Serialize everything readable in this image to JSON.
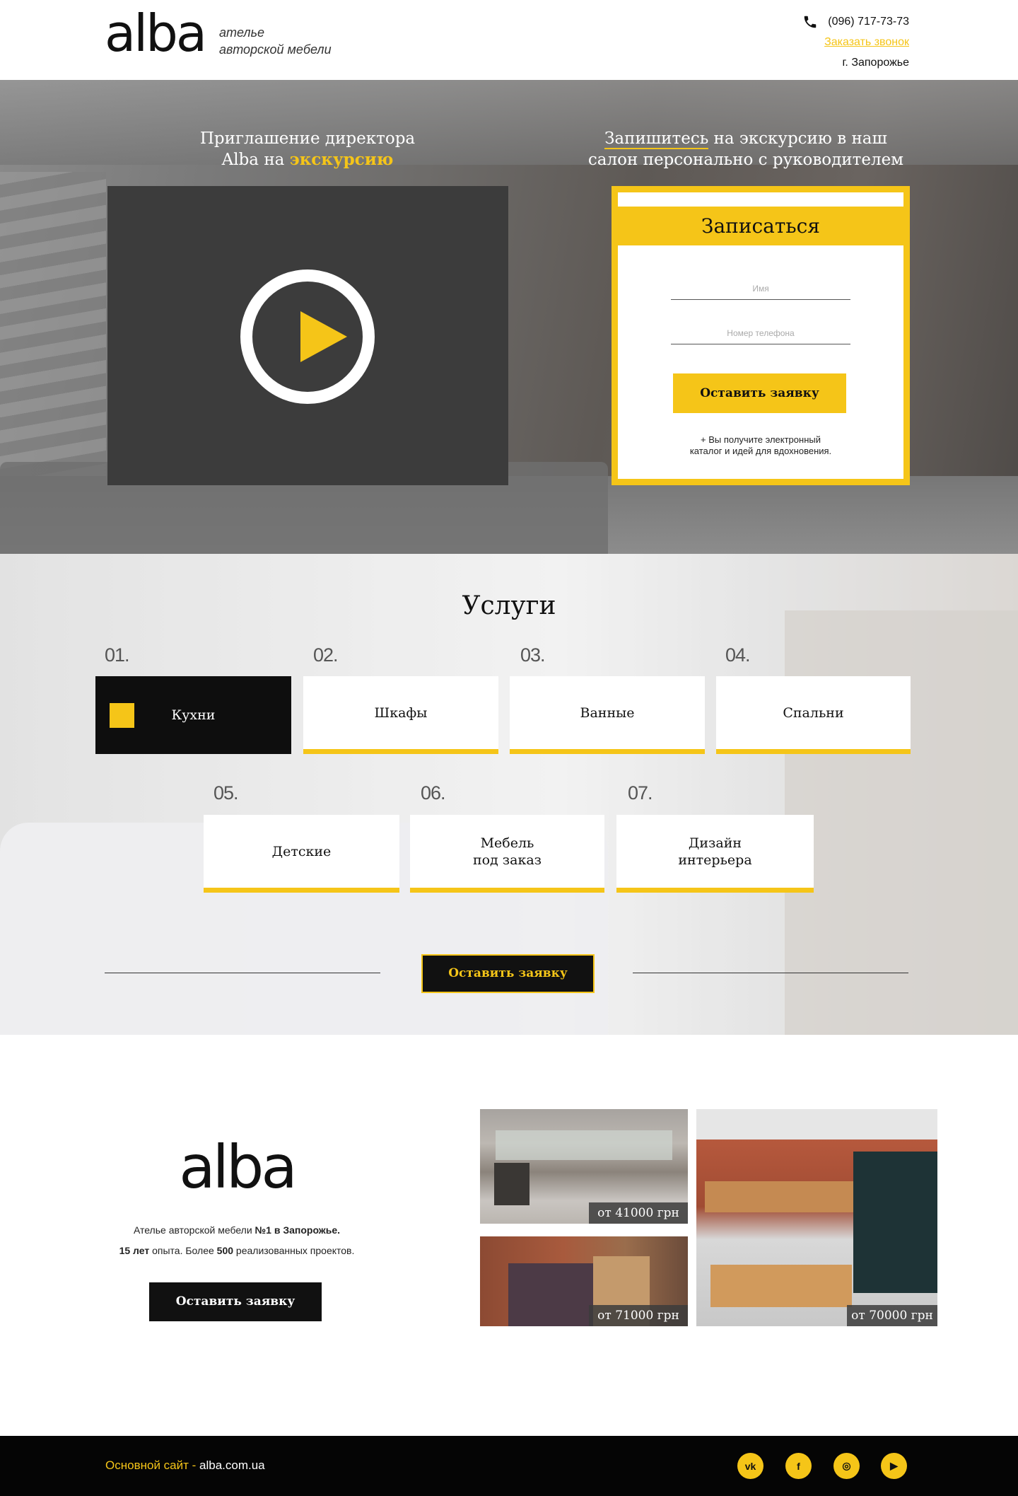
{
  "header": {
    "logo": "alba",
    "tagline_line1": "ателье",
    "tagline_line2": "авторской мебели",
    "phone": "(096) 717-73-73",
    "callback": "Заказать звонок",
    "city": "г. Запорожье"
  },
  "hero": {
    "left_title_line1": "Приглашение директора",
    "left_title_line2_a": "Alba на ",
    "left_title_line2_b": "экскурсию",
    "right_title_underlined": "Запишитесь",
    "right_title_rest1": " на экскурсию в наш",
    "right_title_line2": "салон персонально с руководителем",
    "form": {
      "title": "Записаться",
      "name_placeholder": "Имя",
      "phone_placeholder": "Номер телефона",
      "button": "Оставить заявку",
      "note_line1": "+ Вы получите электронный",
      "note_line2": "каталог и идей для вдохновения."
    }
  },
  "services": {
    "title": "Услуги",
    "items": [
      {
        "num": "01.",
        "label": "Кухни"
      },
      {
        "num": "02.",
        "label": "Шкафы"
      },
      {
        "num": "03.",
        "label": "Ванные"
      },
      {
        "num": "04.",
        "label": "Спальни"
      },
      {
        "num": "05.",
        "label": "Детские"
      },
      {
        "num": "06.",
        "label_line1": "Мебель",
        "label_line2": "под заказ"
      },
      {
        "num": "07.",
        "label_line1": "Дизайн",
        "label_line2": "интерьера"
      }
    ],
    "button": "Оставить заявку"
  },
  "about": {
    "logo": "alba",
    "text_line1_a": "Ателье авторской мебели ",
    "text_line1_b": "№1 в Запорожье.",
    "text_line2_a": "15 лет",
    "text_line2_b": " опыта. Более ",
    "text_line2_c": "500",
    "text_line2_d": " реализованных проектов.",
    "button": "Оставить заявку",
    "photos": [
      {
        "price": "от 41000 грн"
      },
      {
        "price": "от 71000 грн"
      },
      {
        "price": "от 70000 грн"
      }
    ]
  },
  "footer": {
    "label": "Основной сайт - ",
    "site": "alba.com.ua",
    "social": [
      {
        "icon": "vk-icon",
        "glyph": "vk"
      },
      {
        "icon": "facebook-icon",
        "glyph": "f"
      },
      {
        "icon": "instagram-icon",
        "glyph": "◎"
      },
      {
        "icon": "youtube-icon",
        "glyph": "▶"
      }
    ]
  },
  "colors": {
    "accent": "#f5c518",
    "dark": "#0e0e0e"
  }
}
